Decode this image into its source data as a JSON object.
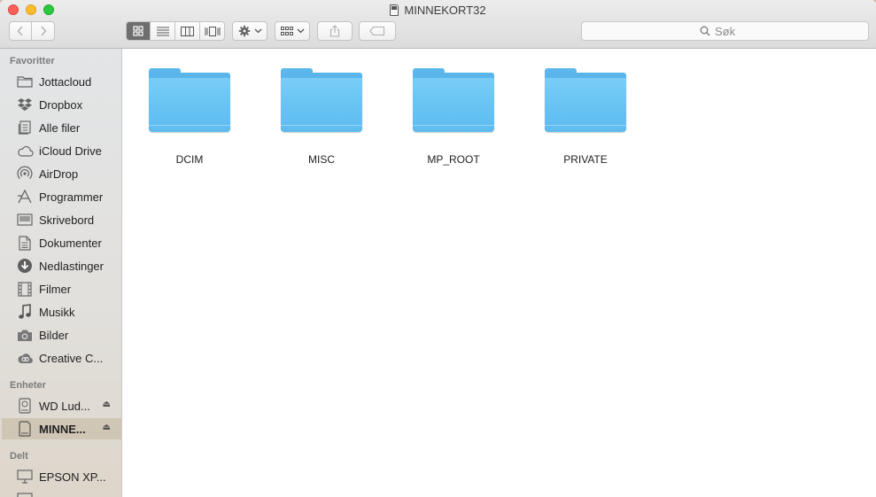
{
  "window": {
    "title": "MINNEKORT32"
  },
  "toolbar": {
    "search_placeholder": "Søk",
    "search_icon": "magnifier-icon",
    "view_modes": [
      "icon-view",
      "list-view",
      "column-view",
      "cover-flow-view"
    ],
    "action_icon": "gear-icon",
    "arrange_icon": "grid-arrange-icon",
    "share_icon": "share-icon",
    "tag_icon": "tag-icon"
  },
  "sidebar": {
    "favorites_header": "Favoritter",
    "favorites": [
      {
        "label": "Jottacloud",
        "icon": "folder-icon"
      },
      {
        "label": "Dropbox",
        "icon": "dropbox-icon"
      },
      {
        "label": "Alle filer",
        "icon": "all-files-icon"
      },
      {
        "label": "iCloud Drive",
        "icon": "cloud-icon"
      },
      {
        "label": "AirDrop",
        "icon": "airdrop-icon"
      },
      {
        "label": "Programmer",
        "icon": "applications-icon"
      },
      {
        "label": "Skrivebord",
        "icon": "desktop-icon"
      },
      {
        "label": "Dokumenter",
        "icon": "document-icon"
      },
      {
        "label": "Nedlastinger",
        "icon": "download-icon"
      },
      {
        "label": "Filmer",
        "icon": "film-icon"
      },
      {
        "label": "Musikk",
        "icon": "music-icon"
      },
      {
        "label": "Bilder",
        "icon": "camera-icon"
      },
      {
        "label": "Creative C...",
        "icon": "creative-cloud-icon"
      }
    ],
    "devices_header": "Enheter",
    "devices": [
      {
        "label": "WD Lud...",
        "icon": "hard-drive-icon",
        "eject": "⏏"
      },
      {
        "label": "MINNE...",
        "icon": "sd-card-icon",
        "eject": "⏏",
        "selected": true
      }
    ],
    "shared_header": "Delt",
    "shared": [
      {
        "label": "EPSON XP...",
        "icon": "monitor-icon"
      }
    ]
  },
  "content": {
    "files": [
      {
        "name": "DCIM",
        "type": "folder"
      },
      {
        "name": "MISC",
        "type": "folder"
      },
      {
        "name": "MP_ROOT",
        "type": "folder"
      },
      {
        "name": "PRIVATE",
        "type": "folder"
      }
    ]
  }
}
